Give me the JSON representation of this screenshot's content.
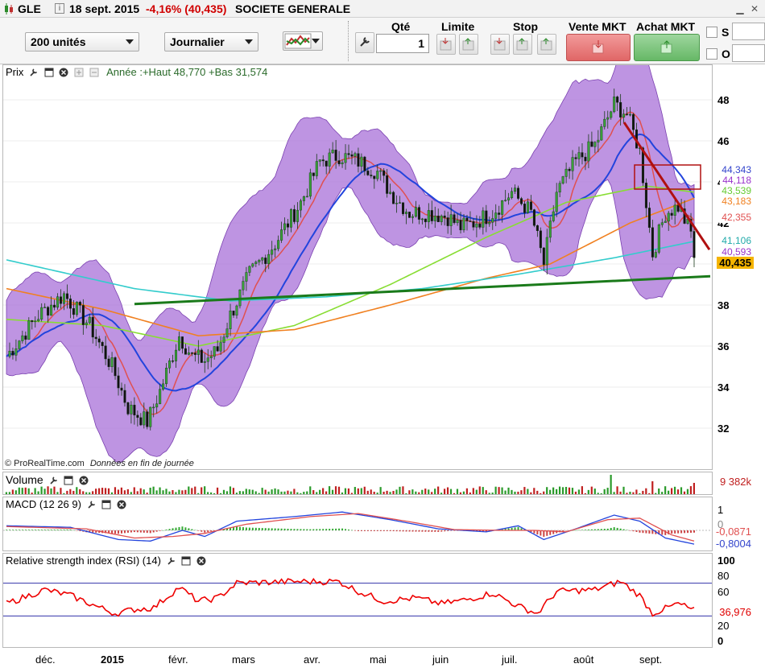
{
  "header": {
    "symbol": "GLE",
    "date": "18 sept. 2015",
    "change": "-4,16% (40,435)",
    "name": "SOCIETE GENERALE"
  },
  "toolbar": {
    "units_select": "200 unités",
    "period_select": "Journalier",
    "qty_label": "Qté",
    "qty_value": "1",
    "limit_label": "Limite",
    "stop_label": "Stop",
    "sell_label": "Vente MKT",
    "buy_label": "Achat MKT",
    "s_label": "S",
    "o_label": "O"
  },
  "price_panel": {
    "title": "Prix",
    "subtitle": "Année :+Haut 48,770 +Bas 31,574",
    "credit": "© ProRealTime.com",
    "credit_note": "Données en fin de journée",
    "y_ticks": [
      "48",
      "46",
      "44",
      "42",
      "40",
      "38",
      "36",
      "34",
      "32"
    ],
    "tags": [
      {
        "text": "44,343",
        "color": "#3344cc"
      },
      {
        "text": "44,118",
        "color": "#9933cc"
      },
      {
        "text": "43,539",
        "color": "#66cc33"
      },
      {
        "text": "43,183",
        "color": "#f08020"
      },
      {
        "text": "42,355",
        "color": "#e05050"
      },
      {
        "text": "41,106",
        "color": "#33cccc"
      },
      {
        "text": "40,593",
        "color": "#9933cc"
      },
      {
        "text": "40,435",
        "color": "#000000"
      }
    ]
  },
  "volume_panel": {
    "title": "Volume",
    "last_value": "9 382k"
  },
  "macd_panel": {
    "title": "MACD (12 26 9)",
    "y_ticks": [
      "1",
      "0"
    ],
    "values": [
      "-0,0871",
      "-0,8004"
    ]
  },
  "rsi_panel": {
    "title": "Relative strength index (RSI) (14)",
    "y_ticks": [
      "100",
      "80",
      "60",
      "40",
      "20",
      "0"
    ],
    "value": "36,976"
  },
  "x_axis": [
    "déc.",
    "2015",
    "févr.",
    "mars",
    "avr.",
    "mai",
    "juin",
    "juil.",
    "août",
    "sept."
  ],
  "colors": {
    "bollinger_fill": "#a870d8",
    "ma_blue": "#2244dd",
    "ma_red": "#e05050",
    "ma_green": "#88dd33",
    "ma_orange": "#f08020",
    "ma_cyan": "#33cccc",
    "trend_support": "#1a7a1a",
    "trend_resistance": "#b01010",
    "rsi_line": "#ee0000"
  }
}
